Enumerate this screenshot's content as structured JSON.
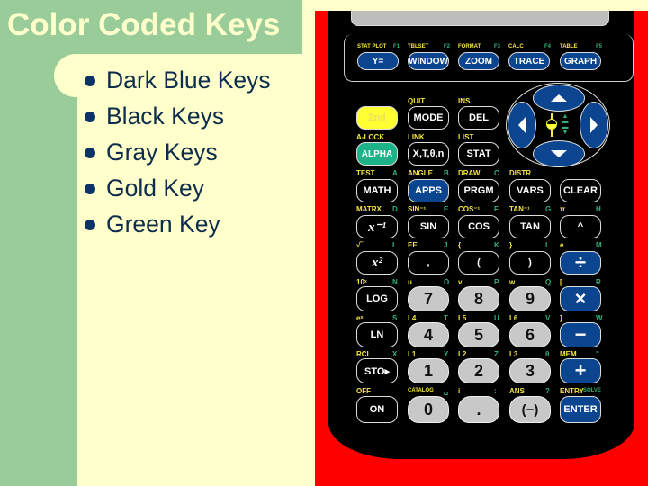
{
  "slide": {
    "title": "Color Coded Keys",
    "bullets": [
      "Dark Blue Keys",
      "Black Keys",
      "Gray Keys",
      "Gold Key",
      "Green Key"
    ],
    "colors": {
      "sidebar": "#99cc99",
      "background": "#ffffcc",
      "title_text": "#ffffcc",
      "bullet_text": "#0d2d4d",
      "calculator_case": "#ff0000",
      "key_dark_blue": "#0b4590",
      "key_gray": "#c8c8c8",
      "key_gold": "#ffff33",
      "key_green": "#1db389"
    }
  },
  "calculator": {
    "fn_row": [
      {
        "second": "STAT PLOT",
        "fkey": "F1",
        "label": "Y="
      },
      {
        "second": "TBLSET",
        "fkey": "F2",
        "label": "WINDOW"
      },
      {
        "second": "FORMAT",
        "fkey": "F3",
        "label": "ZOOM"
      },
      {
        "second": "CALC",
        "fkey": "F4",
        "label": "TRACE"
      },
      {
        "second": "TABLE",
        "fkey": "F5",
        "label": "GRAPH"
      }
    ],
    "row1": [
      {
        "second": "",
        "alpha": "",
        "label": "2nd"
      },
      {
        "second": "QUIT",
        "alpha": "",
        "label": "MODE"
      },
      {
        "second": "INS",
        "alpha": "",
        "label": "DEL"
      }
    ],
    "row2": [
      {
        "second": "A-LOCK",
        "alpha": "",
        "label": "ALPHA"
      },
      {
        "second": "LINK",
        "alpha": "",
        "label": "X,T,θ,n"
      },
      {
        "second": "LIST",
        "alpha": "",
        "label": "STAT"
      }
    ],
    "row3": [
      {
        "second": "TEST",
        "alpha": "A",
        "label": "MATH"
      },
      {
        "second": "ANGLE",
        "alpha": "B",
        "label": "APPS"
      },
      {
        "second": "DRAW",
        "alpha": "C",
        "label": "PRGM"
      },
      {
        "second": "DISTR",
        "alpha": "",
        "label": "VARS"
      },
      {
        "second": "",
        "alpha": "",
        "label": "CLEAR"
      }
    ],
    "row4": [
      {
        "second": "MATRX",
        "alpha": "D",
        "label": "x⁻¹"
      },
      {
        "second": "SIN⁻¹",
        "alpha": "E",
        "label": "SIN"
      },
      {
        "second": "COS⁻¹",
        "alpha": "F",
        "label": "COS"
      },
      {
        "second": "TAN⁻¹",
        "alpha": "G",
        "label": "TAN"
      },
      {
        "second": "π",
        "alpha": "H",
        "label": "^"
      }
    ],
    "row5": [
      {
        "second": "√‾",
        "alpha": "I",
        "label": "x²"
      },
      {
        "second": "EE",
        "alpha": "J",
        "label": ","
      },
      {
        "second": "{",
        "alpha": "K",
        "label": "("
      },
      {
        "second": "}",
        "alpha": "L",
        "label": ")"
      },
      {
        "second": "e",
        "alpha": "M",
        "label": "÷"
      }
    ],
    "row6": [
      {
        "second": "10ˣ",
        "alpha": "N",
        "label": "LOG"
      },
      {
        "second": "u",
        "alpha": "O",
        "label": "7"
      },
      {
        "second": "v",
        "alpha": "P",
        "label": "8"
      },
      {
        "second": "w",
        "alpha": "Q",
        "label": "9"
      },
      {
        "second": "[",
        "alpha": "R",
        "label": "×"
      }
    ],
    "row7": [
      {
        "second": "eˣ",
        "alpha": "S",
        "label": "LN"
      },
      {
        "second": "L4",
        "alpha": "T",
        "label": "4"
      },
      {
        "second": "L5",
        "alpha": "U",
        "label": "5"
      },
      {
        "second": "L6",
        "alpha": "V",
        "label": "6"
      },
      {
        "second": "]",
        "alpha": "W",
        "label": "−"
      }
    ],
    "row8": [
      {
        "second": "RCL",
        "alpha": "X",
        "label": "STO▸"
      },
      {
        "second": "L1",
        "alpha": "Y",
        "label": "1"
      },
      {
        "second": "L2",
        "alpha": "Z",
        "label": "2"
      },
      {
        "second": "L3",
        "alpha": "θ",
        "label": "3"
      },
      {
        "second": "MEM",
        "alpha": "\"",
        "label": "+"
      }
    ],
    "row9": [
      {
        "second": "OFF",
        "alpha": "",
        "label": "ON"
      },
      {
        "second": "CATALOG",
        "alpha": "␣",
        "label": "0"
      },
      {
        "second": "i",
        "alpha": ":",
        "label": "."
      },
      {
        "second": "ANS",
        "alpha": "?",
        "label": "(−)"
      },
      {
        "second": "ENTRY",
        "alpha": "SOLVE",
        "label": "ENTER"
      }
    ]
  }
}
